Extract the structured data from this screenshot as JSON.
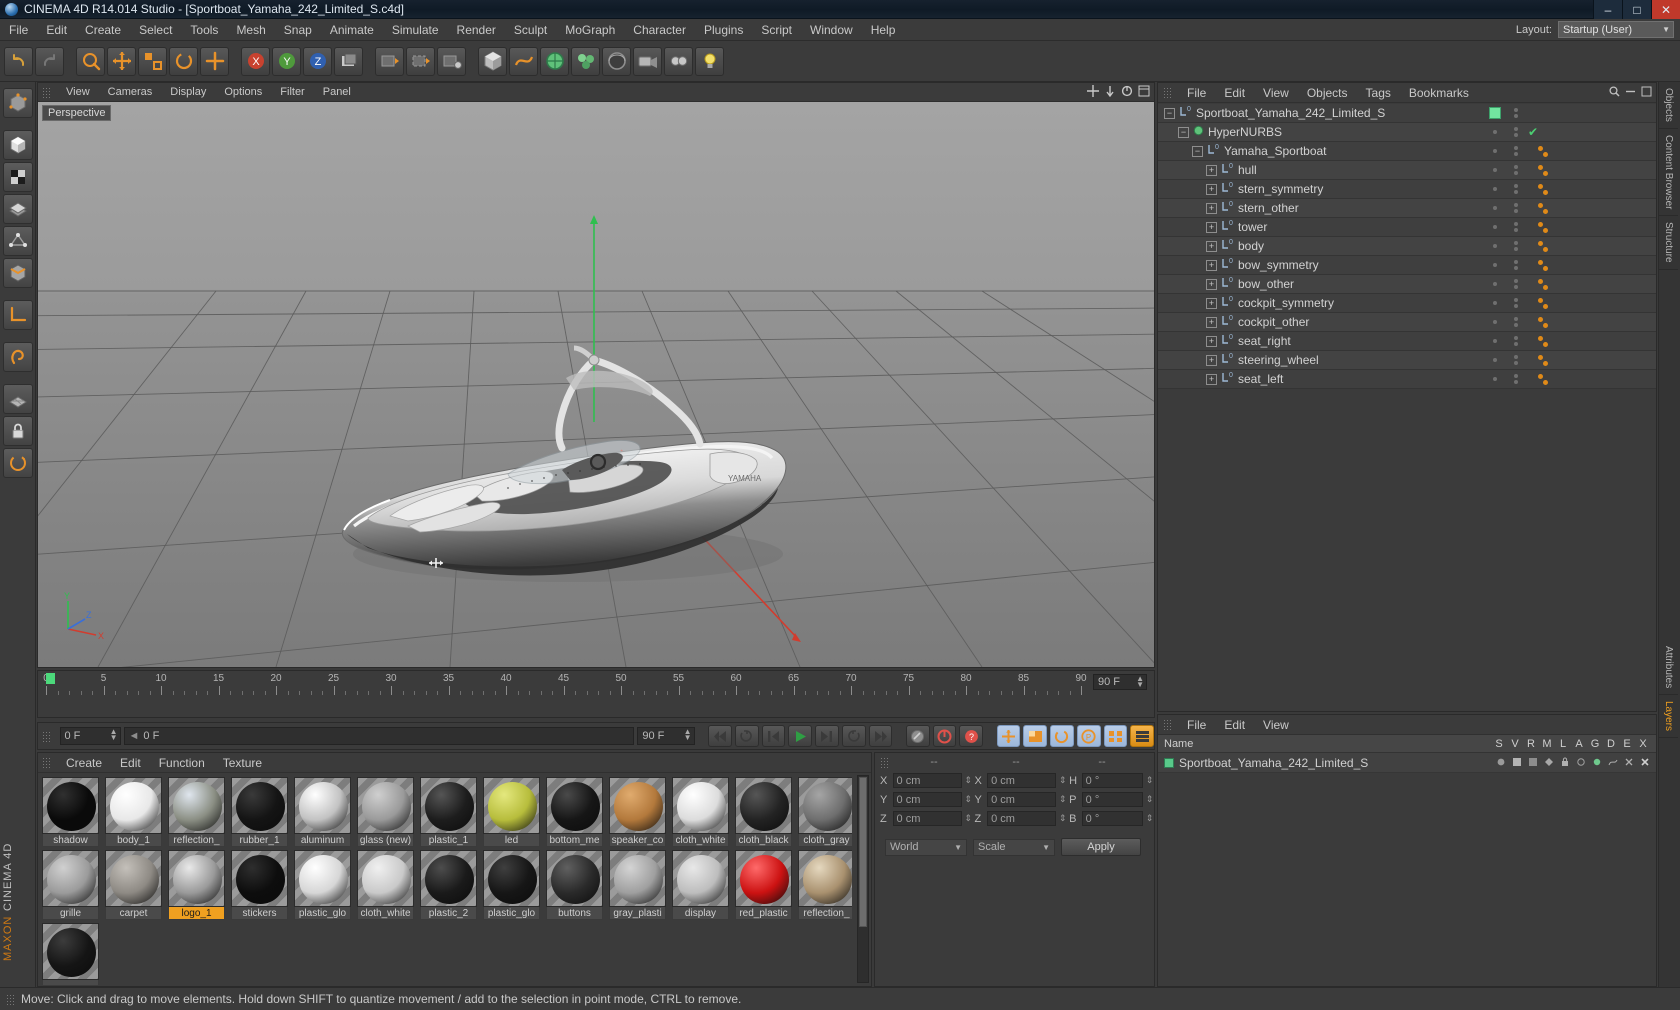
{
  "window": {
    "title": "CINEMA 4D R14.014 Studio - [Sportboat_Yamaha_242_Limited_S.c4d]",
    "minimize": "–",
    "maximize": "□",
    "close": "✕"
  },
  "menubar": {
    "items": [
      "File",
      "Edit",
      "Create",
      "Select",
      "Tools",
      "Mesh",
      "Snap",
      "Animate",
      "Simulate",
      "Render",
      "Sculpt",
      "MoGraph",
      "Character",
      "Plugins",
      "Script",
      "Window",
      "Help"
    ],
    "layout_label": "Layout:",
    "layout_value": "Startup (User)"
  },
  "viewport": {
    "menu": [
      "View",
      "Cameras",
      "Display",
      "Options",
      "Filter",
      "Panel"
    ],
    "camera_label": "Perspective",
    "axis_x": "X",
    "axis_y": "Y",
    "axis_z": "Z"
  },
  "timeline": {
    "ticks": [
      0,
      5,
      10,
      15,
      20,
      25,
      30,
      35,
      40,
      45,
      50,
      55,
      60,
      65,
      70,
      75,
      80,
      85,
      90
    ],
    "current_frame_field": "0 F",
    "start_frame_field": "0 F",
    "preview_start": "0 F",
    "preview_end": "90 F",
    "end_frame_field": "90 F"
  },
  "materials": {
    "menu": [
      "Create",
      "Edit",
      "Function",
      "Texture"
    ],
    "items": [
      {
        "name": "shadow",
        "color": "#0a0a0a",
        "hl": "#303030",
        "selected": false
      },
      {
        "name": "body_1",
        "color": "#e8e8e8",
        "hl": "#ffffff",
        "selected": false
      },
      {
        "name": "reflection_",
        "color": "#8b8f84",
        "hl": "#dfe6ee",
        "selected": false
      },
      {
        "name": "rubber_1",
        "color": "#141414",
        "hl": "#3a3a3a",
        "selected": false
      },
      {
        "name": "aluminum",
        "color": "#c2c2c2",
        "hl": "#ffffff",
        "selected": false
      },
      {
        "name": "glass (new)",
        "color": "#9a9a9a",
        "hl": "#cfcfcf",
        "selected": false
      },
      {
        "name": "plastic_1",
        "color": "#1d1d1d",
        "hl": "#555555",
        "selected": false
      },
      {
        "name": "led",
        "color": "#b7bd3c",
        "hl": "#e4e87e",
        "selected": false
      },
      {
        "name": "bottom_me",
        "color": "#161616",
        "hl": "#4a4a4a",
        "selected": false
      },
      {
        "name": "speaker_co",
        "color": "#b3793c",
        "hl": "#e0ab6e",
        "selected": false
      },
      {
        "name": "cloth_white",
        "color": "#dcdcdc",
        "hl": "#ffffff",
        "selected": false
      },
      {
        "name": "cloth_black",
        "color": "#232323",
        "hl": "#565656",
        "selected": false
      },
      {
        "name": "cloth_gray",
        "color": "#6e6e6e",
        "hl": "#a5a5a5",
        "selected": false
      },
      {
        "name": "grille",
        "color": "#9b9b9b",
        "hl": "#d0d0d0",
        "selected": false
      },
      {
        "name": "carpet",
        "color": "#8e8a84",
        "hl": "#c4c0ba",
        "selected": false
      },
      {
        "name": "logo_1",
        "color": "#9a9a9a",
        "hl": "#e9e9e9",
        "selected": true
      },
      {
        "name": "stickers",
        "color": "#0d0d0d",
        "hl": "#2e2e2e",
        "selected": false
      },
      {
        "name": "plastic_glo",
        "color": "#d6d6d6",
        "hl": "#ffffff",
        "selected": false
      },
      {
        "name": "cloth_white",
        "color": "#c9c9c9",
        "hl": "#f0f0f0",
        "selected": false
      },
      {
        "name": "plastic_2",
        "color": "#1a1a1a",
        "hl": "#4d4d4d",
        "selected": false
      },
      {
        "name": "plastic_glo",
        "color": "#161616",
        "hl": "#3f3f3f",
        "selected": false
      },
      {
        "name": "buttons",
        "color": "#2a2a2a",
        "hl": "#606060",
        "selected": false
      },
      {
        "name": "gray_plasti",
        "color": "#9f9f9f",
        "hl": "#d4d4d4",
        "selected": false
      },
      {
        "name": "display",
        "color": "#bdbdbd",
        "hl": "#e8e8e8",
        "selected": false
      },
      {
        "name": "red_plastic",
        "color": "#cc1212",
        "hl": "#ff6a6a",
        "selected": false
      },
      {
        "name": "reflection_",
        "color": "#a9916f",
        "hl": "#e5d8bf",
        "selected": false
      },
      {
        "name": "",
        "color": "#151515",
        "hl": "#3c3c3c",
        "selected": false
      }
    ]
  },
  "coordinates": {
    "header": [
      "--",
      "--",
      "--"
    ],
    "rows": [
      {
        "label1": "X",
        "value1": "0 cm",
        "label2": "X",
        "value2": "0 cm",
        "label3": "H",
        "value3": "0 °"
      },
      {
        "label1": "Y",
        "value1": "0 cm",
        "label2": "Y",
        "value2": "0 cm",
        "label3": "P",
        "value3": "0 °"
      },
      {
        "label1": "Z",
        "value1": "0 cm",
        "label2": "Z",
        "value2": "0 cm",
        "label3": "B",
        "value3": "0 °"
      }
    ],
    "system": "World",
    "mode": "Scale",
    "apply": "Apply"
  },
  "objects": {
    "menu": [
      "File",
      "Edit",
      "View",
      "Objects",
      "Tags",
      "Bookmarks"
    ],
    "tree": [
      {
        "label": "Sportboat_Yamaha_242_Limited_S",
        "depth": 0,
        "expander": "−",
        "green": true,
        "check": false,
        "tags": 0
      },
      {
        "label": "HyperNURBS",
        "depth": 1,
        "expander": "−",
        "green": false,
        "check": true,
        "tags": 0,
        "hypernurbs": true
      },
      {
        "label": "Yamaha_Sportboat",
        "depth": 2,
        "expander": "−",
        "green": false,
        "check": false,
        "tags": 2
      },
      {
        "label": "hull",
        "depth": 3,
        "expander": "+",
        "green": false,
        "check": false,
        "tags": 2
      },
      {
        "label": "stern_symmetry",
        "depth": 3,
        "expander": "+",
        "green": false,
        "check": false,
        "tags": 2
      },
      {
        "label": "stern_other",
        "depth": 3,
        "expander": "+",
        "green": false,
        "check": false,
        "tags": 2
      },
      {
        "label": "tower",
        "depth": 3,
        "expander": "+",
        "green": false,
        "check": false,
        "tags": 2
      },
      {
        "label": "body",
        "depth": 3,
        "expander": "+",
        "green": false,
        "check": false,
        "tags": 2
      },
      {
        "label": "bow_symmetry",
        "depth": 3,
        "expander": "+",
        "green": false,
        "check": false,
        "tags": 2
      },
      {
        "label": "bow_other",
        "depth": 3,
        "expander": "+",
        "green": false,
        "check": false,
        "tags": 2
      },
      {
        "label": "cockpit_symmetry",
        "depth": 3,
        "expander": "+",
        "green": false,
        "check": false,
        "tags": 2
      },
      {
        "label": "cockpit_other",
        "depth": 3,
        "expander": "+",
        "green": false,
        "check": false,
        "tags": 2
      },
      {
        "label": "seat_right",
        "depth": 3,
        "expander": "+",
        "green": false,
        "check": false,
        "tags": 2
      },
      {
        "label": "steering_wheel",
        "depth": 3,
        "expander": "+",
        "green": false,
        "check": false,
        "tags": 2
      },
      {
        "label": "seat_left",
        "depth": 3,
        "expander": "+",
        "green": false,
        "check": false,
        "tags": 2
      }
    ]
  },
  "layers": {
    "menu": [
      "File",
      "Edit",
      "View"
    ],
    "columns": [
      "Name",
      "S",
      "V",
      "R",
      "M",
      "L",
      "A",
      "G",
      "D",
      "E",
      "X"
    ],
    "rows": [
      {
        "name": "Sportboat_Yamaha_242_Limited_S"
      }
    ]
  },
  "right_tabs": [
    "Objects",
    "Content Browser",
    "Structure",
    "Attributes",
    "Layers"
  ],
  "status": {
    "text": "Move: Click and drag to move elements. Hold down SHIFT to quantize movement / add to the selection in point mode, CTRL to remove."
  },
  "branding": {
    "maxon": "MAXON",
    "cinema4d": "CINEMA 4D"
  },
  "colors": {
    "accent_orange": "#f0a020",
    "selection_blue": "#9cb7da",
    "green": "#72e5a0",
    "red": "#cc1212"
  }
}
